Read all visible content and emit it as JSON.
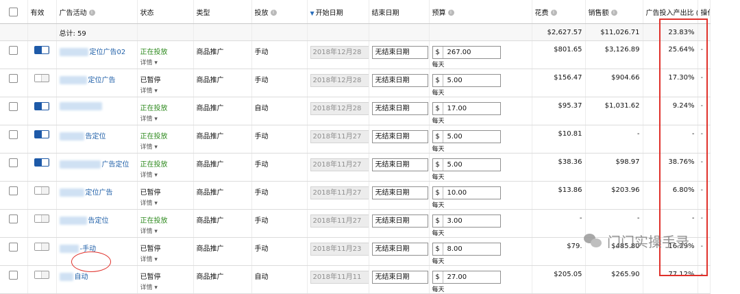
{
  "headers": {
    "active": "有效",
    "campaign": "广告活动",
    "status": "状态",
    "type": "类型",
    "targeting": "投放",
    "start_date": "开始日期",
    "end_date": "结束日期",
    "budget": "预算",
    "spend": "花费",
    "sales": "销售额",
    "acos": "广告投入产出比 (A",
    "actions": "操作"
  },
  "summary": {
    "total_label": "总计: 59",
    "spend": "$2,627.57",
    "sales": "$11,026.71",
    "acos": "23.83%"
  },
  "rows": [
    {
      "active": true,
      "name": "定位广告02",
      "status": "正在投放",
      "status_active": true,
      "details": "详情",
      "type": "商品推广",
      "targeting": "手动",
      "start_date": "2018年12月28",
      "end_date": "无结束日期",
      "currency": "$",
      "budget": "267.00",
      "per_day": "每天",
      "spend": "$801.65",
      "sales": "$3,126.89",
      "acos": "25.64%",
      "action": "-"
    },
    {
      "active": false,
      "name": "定位广告",
      "status": "已暂停",
      "status_active": false,
      "details": "详情",
      "type": "商品推广",
      "targeting": "手动",
      "start_date": "2018年12月28",
      "end_date": "无结束日期",
      "currency": "$",
      "budget": "5.00",
      "per_day": "每天",
      "spend": "$156.47",
      "sales": "$904.66",
      "acos": "17.30%",
      "action": "-"
    },
    {
      "active": true,
      "name": "",
      "status": "正在投放",
      "status_active": true,
      "details": "详情",
      "type": "商品推广",
      "targeting": "自动",
      "start_date": "2018年12月28",
      "end_date": "无结束日期",
      "currency": "$",
      "budget": "17.00",
      "per_day": "每天",
      "spend": "$95.37",
      "sales": "$1,031.62",
      "acos": "9.24%",
      "action": "-"
    },
    {
      "active": true,
      "name": "告定位",
      "status": "正在投放",
      "status_active": true,
      "details": "详情",
      "type": "商品推广",
      "targeting": "手动",
      "start_date": "2018年11月27",
      "end_date": "无结束日期",
      "currency": "$",
      "budget": "5.00",
      "per_day": "每天",
      "spend": "$10.81",
      "sales": "-",
      "acos": "-",
      "action": "-"
    },
    {
      "active": true,
      "name": "广告定位",
      "status": "正在投放",
      "status_active": true,
      "details": "详情",
      "type": "商品推广",
      "targeting": "手动",
      "start_date": "2018年11月27",
      "end_date": "无结束日期",
      "currency": "$",
      "budget": "5.00",
      "per_day": "每天",
      "spend": "$38.36",
      "sales": "$98.97",
      "acos": "38.76%",
      "action": "-"
    },
    {
      "active": false,
      "name": "定位广告",
      "status": "已暂停",
      "status_active": false,
      "details": "详情",
      "type": "商品推广",
      "targeting": "手动",
      "start_date": "2018年11月27",
      "end_date": "无结束日期",
      "currency": "$",
      "budget": "10.00",
      "per_day": "每天",
      "spend": "$13.86",
      "sales": "$203.96",
      "acos": "6.80%",
      "action": "-"
    },
    {
      "active": false,
      "name": "告定位",
      "status": "正在投放",
      "status_active": true,
      "details": "详情",
      "type": "商品推广",
      "targeting": "手动",
      "start_date": "2018年11月27",
      "end_date": "无结束日期",
      "currency": "$",
      "budget": "3.00",
      "per_day": "每天",
      "spend": "-",
      "sales": "-",
      "acos": "-",
      "action": "-"
    },
    {
      "active": false,
      "name": "-手动",
      "status": "已暂停",
      "status_active": false,
      "details": "详情",
      "type": "商品推广",
      "targeting": "手动",
      "start_date": "2018年11月23",
      "end_date": "无结束日期",
      "currency": "$",
      "budget": "8.00",
      "per_day": "每天",
      "spend": "$79.",
      "sales": "$485.80",
      "acos": "16.29%",
      "action": "-"
    },
    {
      "active": false,
      "name": "自动",
      "status": "已暂停",
      "status_active": false,
      "details": "详情",
      "type": "商品推广",
      "targeting": "自动",
      "start_date": "2018年11月11",
      "end_date": "无结束日期",
      "currency": "$",
      "budget": "27.00",
      "per_day": "每天",
      "spend": "$205.05",
      "sales": "$265.90",
      "acos": "77.12%",
      "action": "-"
    }
  ],
  "watermark": "门门实操手录",
  "colors": {
    "toggle_on": "#1e5aa8",
    "status_active": "#2e8a1e",
    "link": "#1f5fa8",
    "highlight_red": "#e0302a"
  }
}
